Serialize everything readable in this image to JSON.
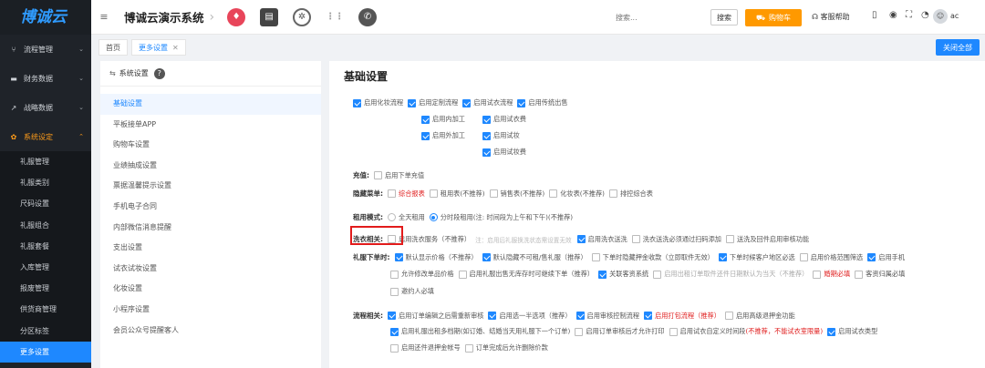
{
  "sidebar": {
    "logo": "博诚云",
    "menus": [
      {
        "label": "流程管理",
        "icon": "flow-icon",
        "glyph": "⑂"
      },
      {
        "label": "财务数据",
        "icon": "wallet-icon",
        "glyph": "▬"
      },
      {
        "label": "战略数据",
        "icon": "trend-icon",
        "glyph": "↗"
      },
      {
        "label": "系统设定",
        "icon": "gear-icon",
        "glyph": "✿"
      }
    ],
    "sub_items": [
      "礼服管理",
      "礼服类别",
      "尺码设置",
      "礼服组合",
      "礼服套餐",
      "入库管理",
      "报废管理",
      "供货商管理",
      "分区标签",
      "更多设置"
    ]
  },
  "header": {
    "system_title": "博诚云演示系统",
    "search_placeholder": "搜索...",
    "search_button": "搜索",
    "cart_button": "购物车",
    "help": "客服帮助",
    "user": "ac"
  },
  "tabs": {
    "items": [
      {
        "label": "首页"
      },
      {
        "label": "更多设置"
      }
    ],
    "close_all": "关闭全部"
  },
  "settings_nav": {
    "header": "系统设置",
    "items": [
      "基础设置",
      "平板接单APP",
      "购物车设置",
      "业绩抽成设置",
      "票据温馨提示设置",
      "手机电子合同",
      "内部微信消息提醒",
      "支出设置",
      "试衣试妆设置",
      "化妆设置",
      "小程序设置",
      "会员公众号提醒客人"
    ]
  },
  "content": {
    "title": "基础设置",
    "top_flows": [
      "启用化妆流程",
      "启用定制流程",
      "启用试衣流程",
      "启用传统出售"
    ],
    "custom_sub": [
      "启用内加工",
      "启用外加工"
    ],
    "tryon_sub": [
      "启用试衣费",
      "启用试妆",
      "启用试妆费"
    ],
    "charge": {
      "label": "充值:",
      "option": "启用下单充值"
    },
    "hidden": {
      "label": "隐藏菜单:",
      "options": [
        "综合报表",
        "租用表(不推荐)",
        "销售表(不推荐)",
        "化妆表(不推荐)",
        "排控综合表"
      ]
    },
    "rent_mode": {
      "label": "租用模式:",
      "options": [
        "全天租用",
        "分时段租用(注: 时间段为上午和下午)(不推荐)"
      ]
    },
    "wash": {
      "label": "洗衣相关:",
      "options": [
        "启用洗衣服务（不推荐）",
        "启用洗衣送洗",
        "洗衣送洗必须通过扫码添加",
        "送洗及回件启用审核功能"
      ],
      "hint": "注：启用后礼服换洗状态需设置无效"
    },
    "order": {
      "label": "礼服下单时:",
      "row1": [
        "默认显示价格（不推荐）",
        "默认隐藏不可租/售礼服（推荐）",
        "下单时隐藏押金收款（立即取件无效）",
        "下单时候客户地区必选",
        "启用价格范围筛选",
        "启用手机"
      ],
      "row2": [
        "允许修改单品价格",
        "启用礼服出售无库存时可继续下单（推荐）",
        "关联客资系统",
        "启用出租订单取件还件日期默认为当天（不推荐）",
        "婚期必填",
        "客资归属必填"
      ],
      "row3": [
        "邀约人必填"
      ]
    },
    "process": {
      "label": "流程相关:",
      "row1": [
        "启用订单编辑之后需重新审核",
        "启用选一半选项（推荐）",
        "启用审核控制流程",
        "启用打包流程（推荐）",
        "启用高级退押金功能"
      ],
      "row2": [
        "启用礼服出租多档期(如订婚、结婚当天用礼服下一个订单)",
        "启用订单审核后才允许打印",
        "启用试衣自定义时间段",
        "(不推荐，不能试衣室限量)",
        "启用试衣类型"
      ],
      "row3": [
        "启用还件退押金帐号",
        "订单完成后允许删除价款"
      ]
    }
  },
  "colors": {
    "accent": "#1e88ff",
    "cart": "#ff9900",
    "sidebar_bg": "#1f2329",
    "highlight": "#e21b1b",
    "warning_text": "#e02020"
  }
}
